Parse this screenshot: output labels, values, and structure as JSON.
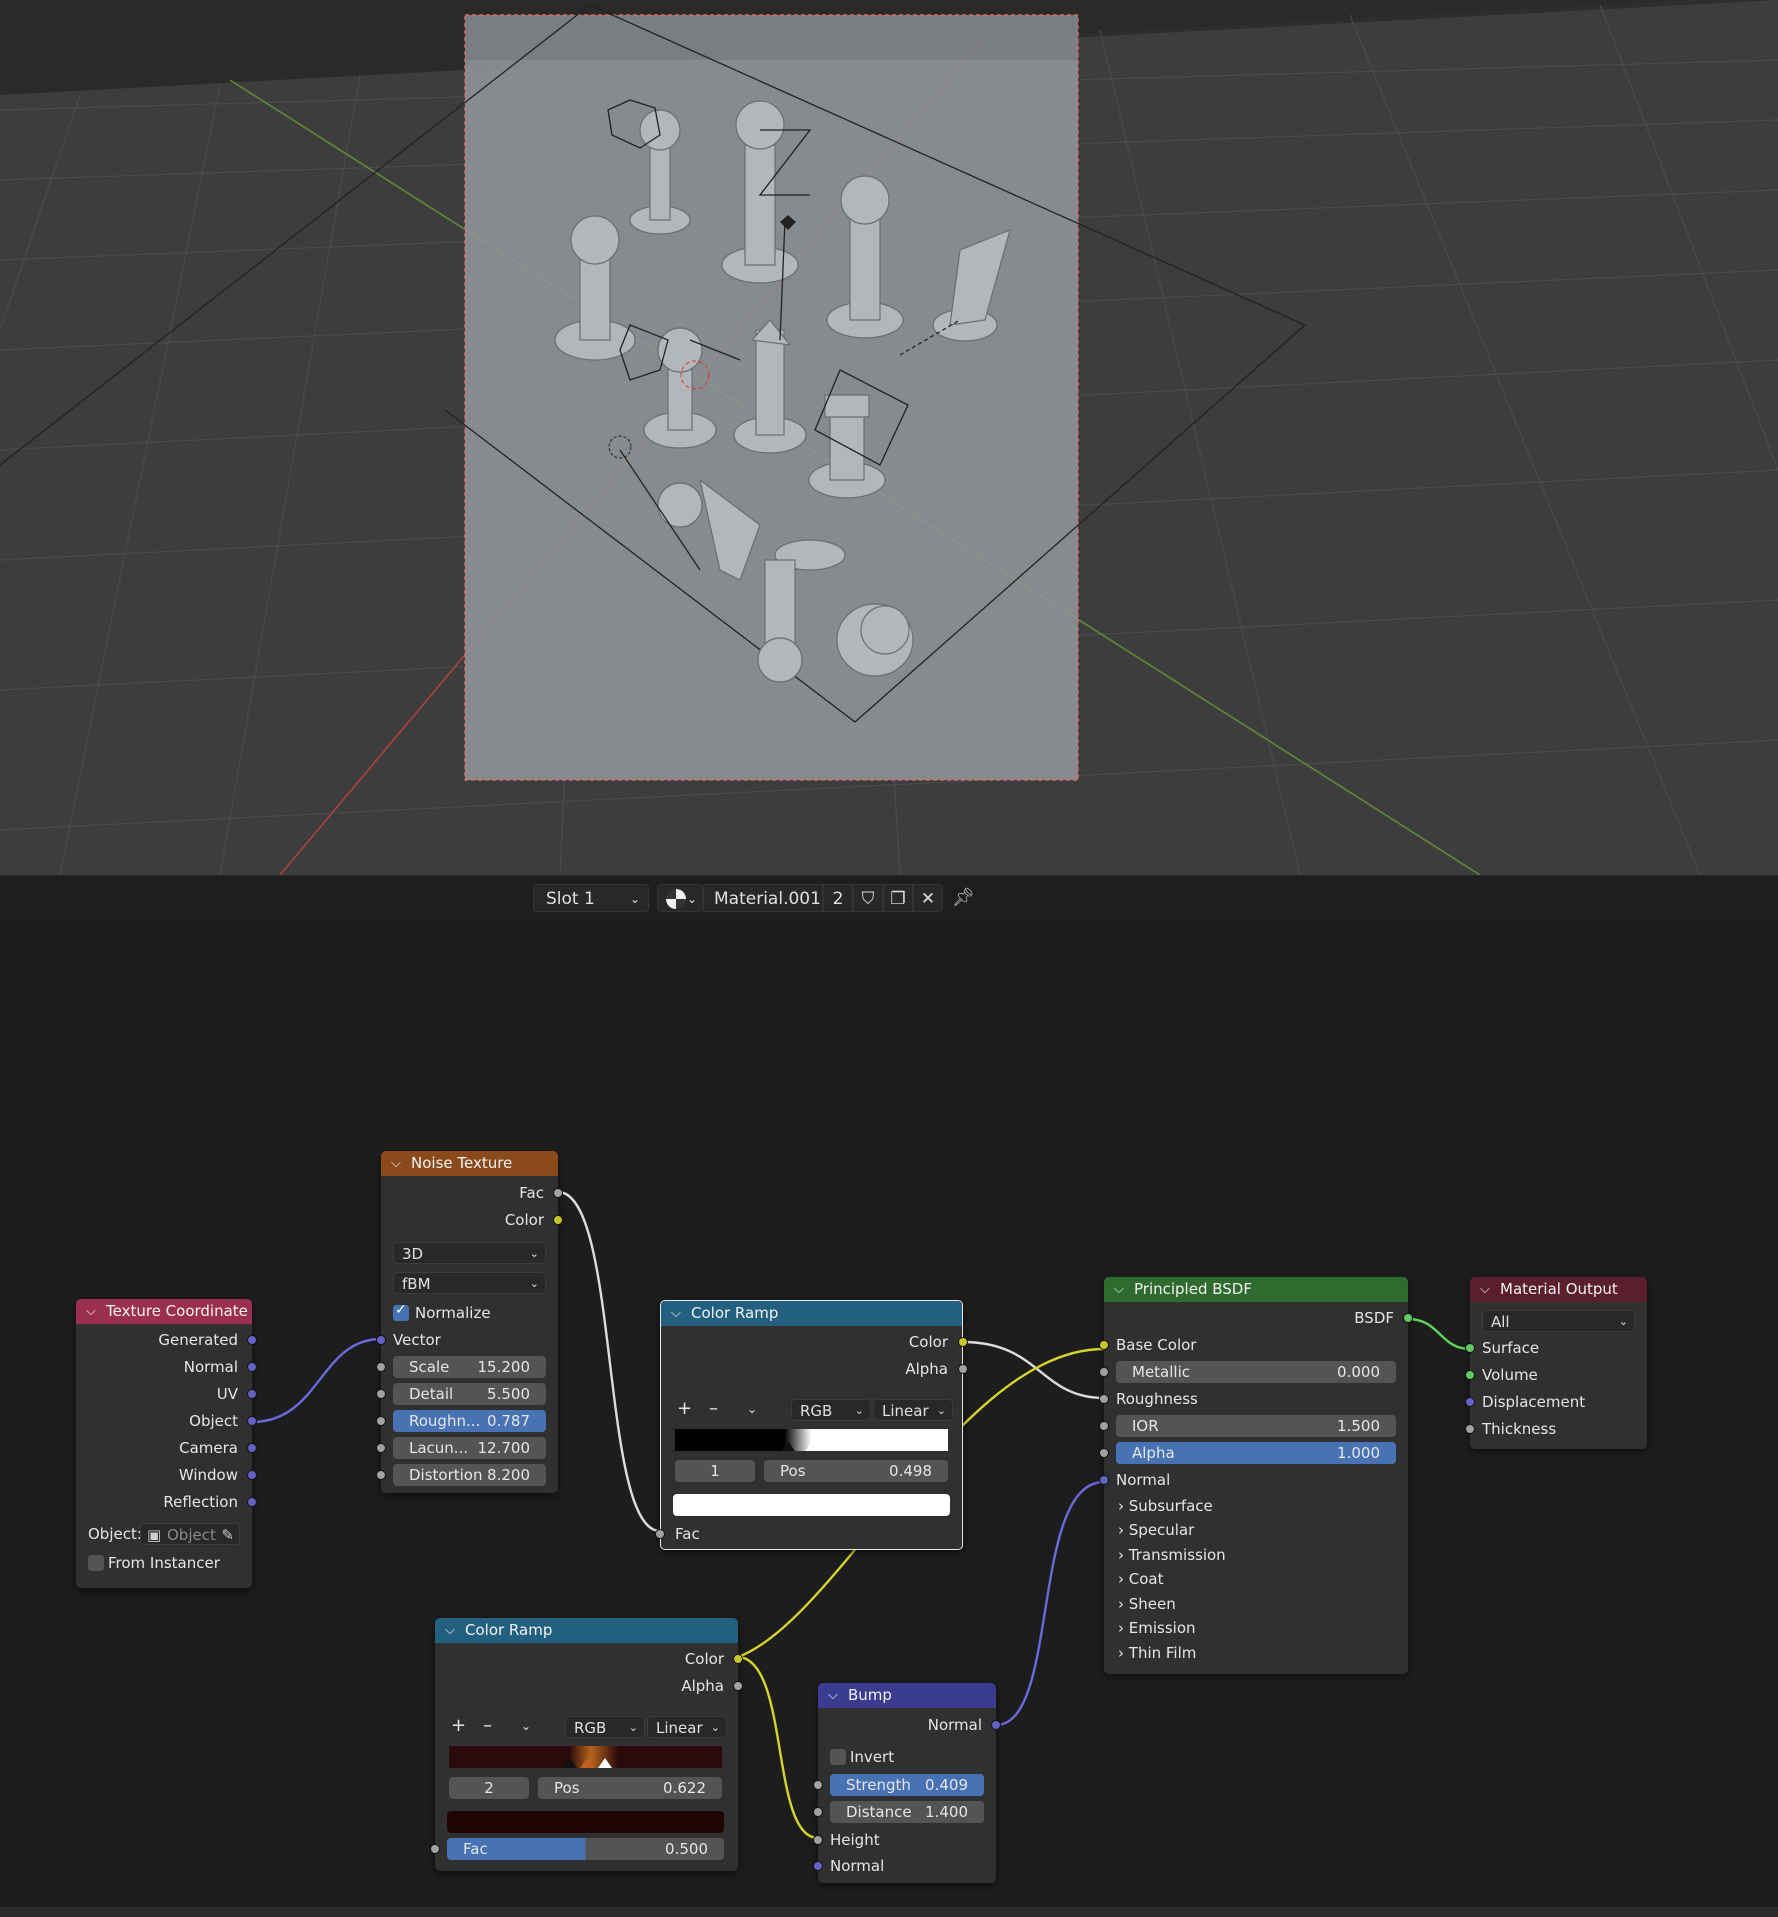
{
  "header": {
    "slot": "Slot 1",
    "material_name": "Material.001",
    "user_count": "2"
  },
  "nodes": {
    "noise_texture": {
      "title": "Noise Texture",
      "outputs": [
        "Fac",
        "Color"
      ],
      "dimensions": "3D",
      "type": "fBM",
      "normalize_label": "Normalize",
      "inputs_label": "Vector",
      "params": [
        {
          "label": "Scale",
          "value": "15.200"
        },
        {
          "label": "Detail",
          "value": "5.500"
        },
        {
          "label": "Roughn...",
          "value": "0.787"
        },
        {
          "label": "Lacun...",
          "value": "12.700"
        },
        {
          "label": "Distortion",
          "value": "8.200"
        }
      ]
    },
    "texture_coordinate": {
      "title": "Texture Coordinate",
      "outputs": [
        "Generated",
        "Normal",
        "UV",
        "Object",
        "Camera",
        "Window",
        "Reflection"
      ],
      "object_label": "Object:",
      "object_placeholder": "Object",
      "from_instancer": "From Instancer"
    },
    "color_ramp_1": {
      "title": "Color Ramp",
      "outputs": [
        "Color",
        "Alpha"
      ],
      "mode": "RGB",
      "interp": "Linear",
      "index": "1",
      "pos_label": "Pos",
      "pos_value": "0.498",
      "input": "Fac"
    },
    "color_ramp_2": {
      "title": "Color Ramp",
      "outputs": [
        "Color",
        "Alpha"
      ],
      "mode": "RGB",
      "interp": "Linear",
      "index": "2",
      "pos_label": "Pos",
      "pos_value": "0.622",
      "fac_label": "Fac",
      "fac_value": "0.500"
    },
    "principled": {
      "title": "Principled BSDF",
      "output": "BSDF",
      "base_color": "Base Color",
      "metallic": {
        "label": "Metallic",
        "value": "0.000"
      },
      "roughness": "Roughness",
      "ior": {
        "label": "IOR",
        "value": "1.500"
      },
      "alpha": {
        "label": "Alpha",
        "value": "1.000"
      },
      "normal": "Normal",
      "panels": [
        "Subsurface",
        "Specular",
        "Transmission",
        "Coat",
        "Sheen",
        "Emission",
        "Thin Film"
      ]
    },
    "material_output": {
      "title": "Material Output",
      "target": "All",
      "inputs": [
        "Surface",
        "Volume",
        "Displacement",
        "Thickness"
      ]
    },
    "bump": {
      "title": "Bump",
      "output": "Normal",
      "invert": "Invert",
      "strength": {
        "label": "Strength",
        "value": "0.409"
      },
      "distance": {
        "label": "Distance",
        "value": "1.400"
      },
      "inputs": [
        "Height",
        "Normal"
      ]
    }
  },
  "colors": {
    "noise_header": "#8a4a1c",
    "texcoord_header": "#9b2f4f",
    "ramp_header": "#23607f",
    "principled_header": "#2f6b2f",
    "output_header": "#5a1e2e",
    "bump_header": "#3b3b8f"
  }
}
